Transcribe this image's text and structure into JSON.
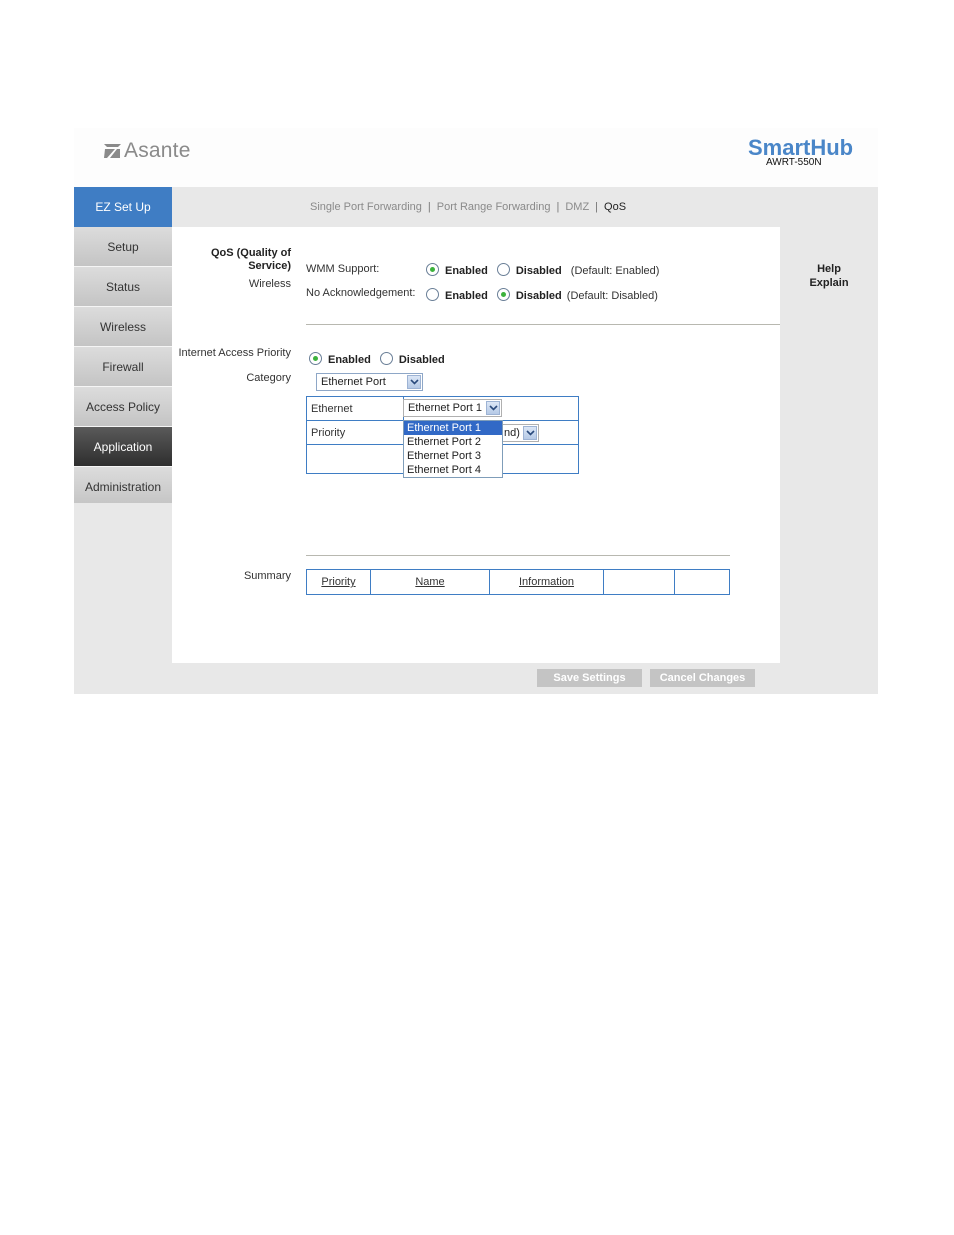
{
  "header": {
    "logo_text": "Asante",
    "brand_name": "SmartHub",
    "model": "AWRT-550N"
  },
  "topnav": {
    "ez_setup": "EZ Set Up",
    "subnav": [
      {
        "label": "Single Port Forwarding",
        "active": false
      },
      {
        "label": "Port Range Forwarding",
        "active": false
      },
      {
        "label": "DMZ",
        "active": false
      },
      {
        "label": "QoS",
        "active": true
      }
    ],
    "separator": "|"
  },
  "sidebar": {
    "items": [
      {
        "label": "Setup"
      },
      {
        "label": "Status"
      },
      {
        "label": "Wireless"
      },
      {
        "label": "Firewall"
      },
      {
        "label": "Access Policy"
      },
      {
        "label": "Application",
        "active": true
      },
      {
        "label": "Administration"
      }
    ]
  },
  "help": {
    "line1": "Help",
    "line2": "Explain"
  },
  "qos": {
    "section_title_line1": "QoS (Quality of",
    "section_title_line2": "Service)",
    "wireless_label": "Wireless",
    "wmm": {
      "label": "WMM Support:",
      "enabled_label": "Enabled",
      "disabled_label": "Disabled",
      "selected": "Enabled",
      "default_text": "(Default: Enabled)"
    },
    "no_ack": {
      "label": "No Acknowledgement:",
      "enabled_label": "Enabled",
      "disabled_label": "Disabled",
      "selected": "Disabled",
      "default_text": "(Default: Disabled)"
    },
    "internet_access_priority": {
      "label": "Internet Access Priority",
      "enabled_label": "Enabled",
      "disabled_label": "Disabled",
      "selected": "Enabled"
    },
    "category": {
      "label": "Category",
      "value": "Ethernet Port"
    },
    "ethernet_row": {
      "label": "Ethernet",
      "value": "Ethernet Port 1",
      "options": [
        "Ethernet Port 1",
        "Ethernet Port 2",
        "Ethernet Port 3",
        "Ethernet Port 4"
      ],
      "highlighted": "Ethernet Port 1"
    },
    "priority_row": {
      "label": "Priority",
      "value_visible": "nd)"
    },
    "summary": {
      "label": "Summary",
      "columns": [
        "Priority",
        "Name",
        "Information",
        "",
        ""
      ]
    }
  },
  "buttons": {
    "save": "Save Settings",
    "cancel": "Cancel Changes"
  },
  "colors": {
    "accent": "#3f7dc4",
    "brand": "#4a86c8",
    "active_nav": "#3a3a3a",
    "radio_on": "#3cb23c"
  }
}
